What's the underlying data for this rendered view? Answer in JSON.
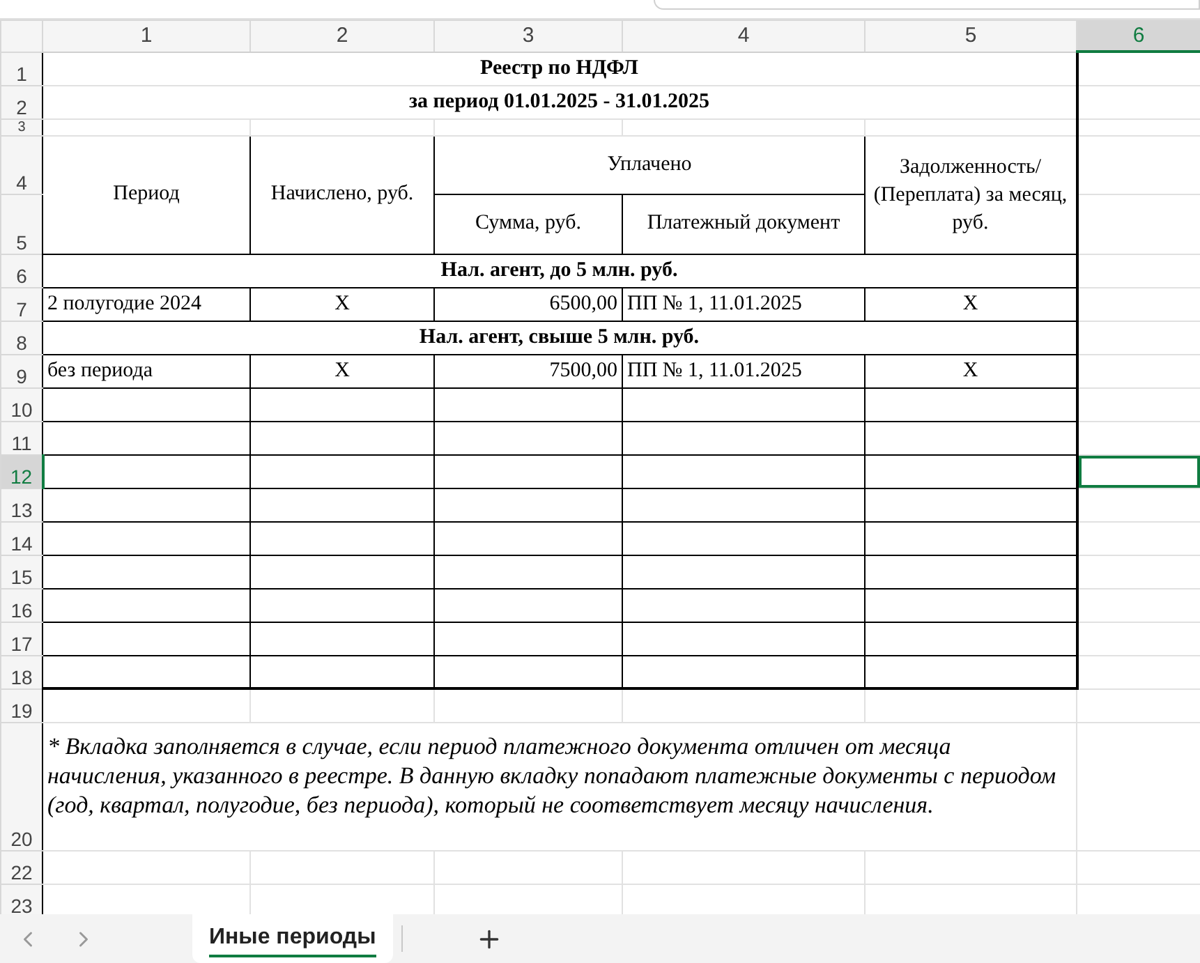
{
  "columns": [
    {
      "label": "1",
      "selected": false
    },
    {
      "label": "2",
      "selected": false
    },
    {
      "label": "3",
      "selected": false
    },
    {
      "label": "4",
      "selected": false
    },
    {
      "label": "5",
      "selected": false
    },
    {
      "label": "6",
      "selected": true
    }
  ],
  "rows": [
    {
      "number": "1",
      "selected": false,
      "kind": "title",
      "text": "Реестр по НДФЛ"
    },
    {
      "number": "2",
      "selected": false,
      "kind": "title",
      "text": "за период 01.01.2025 - 31.01.2025"
    },
    {
      "number": "3",
      "selected": false,
      "kind": "blank"
    },
    {
      "number": "4",
      "selected": false,
      "kind": "header_top",
      "period": "Период",
      "accrued": "Начислено, руб.",
      "paid": "Уплачено",
      "debt": "Задолженность/ (Переплата) за месяц, руб."
    },
    {
      "number": "5",
      "selected": false,
      "kind": "header_bottom",
      "sum": "Сумма, руб.",
      "document": "Платежный документ"
    },
    {
      "number": "6",
      "selected": false,
      "kind": "group",
      "text": "Нал. агент, до 5 млн. руб."
    },
    {
      "number": "7",
      "selected": false,
      "kind": "data",
      "cells": [
        "2 полугодие 2024",
        "X",
        "6500,00",
        "ПП № 1, 11.01.2025",
        "X"
      ]
    },
    {
      "number": "8",
      "selected": false,
      "kind": "group",
      "text": "Нал. агент, свыше 5 млн. руб."
    },
    {
      "number": "9",
      "selected": false,
      "kind": "data",
      "cells": [
        "без периода",
        "X",
        "7500,00",
        "ПП № 1, 11.01.2025",
        "X"
      ]
    },
    {
      "number": "10",
      "selected": false,
      "kind": "empty"
    },
    {
      "number": "11",
      "selected": false,
      "kind": "empty"
    },
    {
      "number": "12",
      "selected": true,
      "kind": "empty"
    },
    {
      "number": "13",
      "selected": false,
      "kind": "empty"
    },
    {
      "number": "14",
      "selected": false,
      "kind": "empty"
    },
    {
      "number": "15",
      "selected": false,
      "kind": "empty"
    },
    {
      "number": "16",
      "selected": false,
      "kind": "empty"
    },
    {
      "number": "17",
      "selected": false,
      "kind": "empty"
    },
    {
      "number": "18",
      "selected": false,
      "kind": "empty"
    },
    {
      "number": "19",
      "selected": false,
      "kind": "outside"
    },
    {
      "number": "20",
      "selected": false,
      "kind": "note",
      "text": "* Вкладка заполняется в случае, если период платежного документа отличен от месяца начисления, указанного в реестре. В данную вкладку попадают платежные документы с периодом (год, квартал, полугодие, без периода), который не соответствует месяцу начисления."
    },
    {
      "number": "22",
      "selected": false,
      "kind": "outside"
    },
    {
      "number": "23",
      "selected": false,
      "kind": "outside"
    }
  ],
  "sheet_tabs": [
    {
      "label": "Иные периоды",
      "selected": true
    }
  ]
}
